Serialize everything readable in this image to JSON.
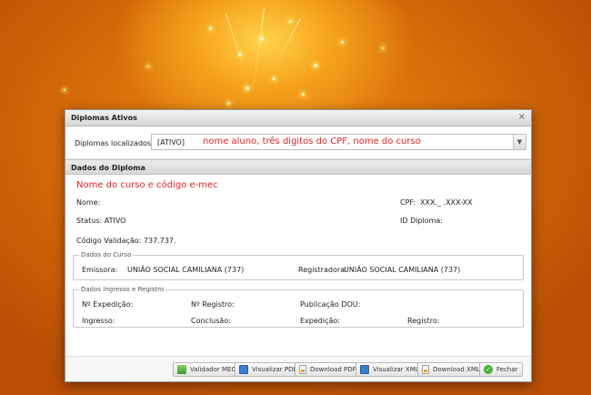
{
  "dialog": {
    "title": "Diplomas Ativos",
    "close_icon": "close-icon"
  },
  "locator": {
    "label": "Diplomas localizados:",
    "selected_value": "[ATIVO]",
    "hint": "nome aluno, três digitos do CPF, nome do curso"
  },
  "section": {
    "title": "Dados do Diploma"
  },
  "diploma": {
    "course_title": "Nome do curso e código e-mec",
    "nome_label": "Nome:",
    "status_text": "Status: ATIVO",
    "validation_text": "Código Validação: 737.737.",
    "cpf_label": "CPF:",
    "cpf_value": "XXX._ .XXX-XX",
    "id_label": "ID Diploma:"
  },
  "curso": {
    "legend": "Dados do Curso",
    "emissora_label": "Emissora:",
    "emissora_value": "UNIÃO SOCIAL CAMILIANA (737)",
    "registradora_label": "Registradora:",
    "registradora_value": "UNIÃO SOCIAL CAMILIANA (737)"
  },
  "ingresso": {
    "legend": "Dados Ingresso e Registro",
    "expedicao_no": "Nº Expedição:",
    "registro_no": "Nº Registro:",
    "publicacao": "Publicação DOU:",
    "ingresso": "Ingresso:",
    "conclusao": "Conclusão:",
    "expedicao": "Expedição:",
    "registro": "Registro:"
  },
  "buttons": [
    {
      "label": "Validador MEC",
      "icon": "mec-icon"
    },
    {
      "label": "Visualizar PDF",
      "icon": "pdf-icon"
    },
    {
      "label": "Download PDF",
      "icon": "download-icon"
    },
    {
      "label": "Visualizar XML",
      "icon": "xml-icon"
    },
    {
      "label": "Download XML",
      "icon": "download-icon"
    },
    {
      "label": "Fechar",
      "icon": "ok-icon"
    }
  ],
  "colors": {
    "accent_red": "#e02020",
    "background": "#d36a08"
  }
}
